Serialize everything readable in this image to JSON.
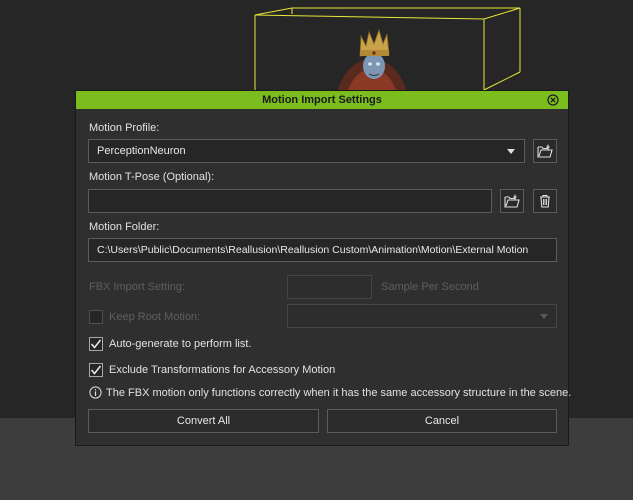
{
  "dialog": {
    "title": "Motion Import Settings",
    "accent_color": "#7cbd1e",
    "close_icon": "close-circle-icon"
  },
  "motion_profile": {
    "label": "Motion Profile:",
    "value": "PerceptionNeuron",
    "browse_icon": "folder-open-icon"
  },
  "tpose": {
    "label": "Motion T-Pose (Optional):",
    "value": "",
    "browse_icon": "folder-open-icon",
    "delete_icon": "trash-icon"
  },
  "motion_folder": {
    "label": "Motion Folder:",
    "value": "C:\\Users\\Public\\Documents\\Reallusion\\Reallusion Custom\\Animation\\Motion\\External Motion"
  },
  "fbx_import": {
    "label": "FBX Import Setting:",
    "value": "",
    "unit_label": "Sample Per Second"
  },
  "keep_root_motion": {
    "label": "Keep Root Motion:",
    "checked": false,
    "value": ""
  },
  "auto_generate": {
    "label": "Auto-generate to perform list.",
    "checked": true
  },
  "exclude_transformations": {
    "label": "Exclude Transformations for Accessory Motion",
    "checked": true
  },
  "info": {
    "icon": "info-icon",
    "text": "The FBX motion only functions correctly when it has the same accessory structure in the scene."
  },
  "buttons": {
    "convert_all": "Convert All",
    "cancel": "Cancel"
  },
  "viewport": {
    "bounding_box_color": "#e8e83a"
  }
}
